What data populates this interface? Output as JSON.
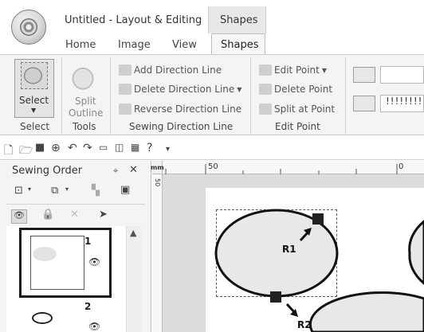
{
  "window": {
    "title": "Untitled - Layout & Editing",
    "context_tab": "Shapes"
  },
  "ribbon_tabs": [
    "Home",
    "Image",
    "View",
    "Shapes"
  ],
  "ribbon": {
    "select_group": {
      "button_label": "Select",
      "group_label": "Select"
    },
    "tools_group": {
      "split_label": "Split",
      "outline_label": "Outline",
      "group_label": "Tools"
    },
    "sewing_direction_group": {
      "add": "Add Direction Line",
      "delete": "Delete Direction Line",
      "reverse": "Reverse Direction Line",
      "group_label": "Sewing Direction Line"
    },
    "edit_point_group": {
      "edit": "Edit Point",
      "delete": "Delete Point",
      "split": "Split at Point",
      "group_label": "Edit Point"
    },
    "stitch_pattern": "!!!!!!!!"
  },
  "quick_access_toolbar": [
    "new-icon",
    "open-icon",
    "save-icon",
    "zoom-icon",
    "undo-icon",
    "redo-icon",
    "preview-icon",
    "realistic-icon",
    "properties-icon",
    "help-icon",
    "customize-icon"
  ],
  "sewing_order_panel": {
    "title": "Sewing Order",
    "items": [
      {
        "number": "1"
      },
      {
        "number": "2"
      }
    ]
  },
  "ruler": {
    "unit": "mm",
    "h_labels": [
      "50",
      "0"
    ],
    "v_label": "50"
  },
  "canvas": {
    "shapes": [
      {
        "label": "R1"
      },
      {
        "label": "R2"
      }
    ]
  },
  "colors": {
    "ribbon_bg": "#f4f4f4",
    "selection_border": "#1a1a1a",
    "canvas_bg": "#dcdcdc"
  }
}
